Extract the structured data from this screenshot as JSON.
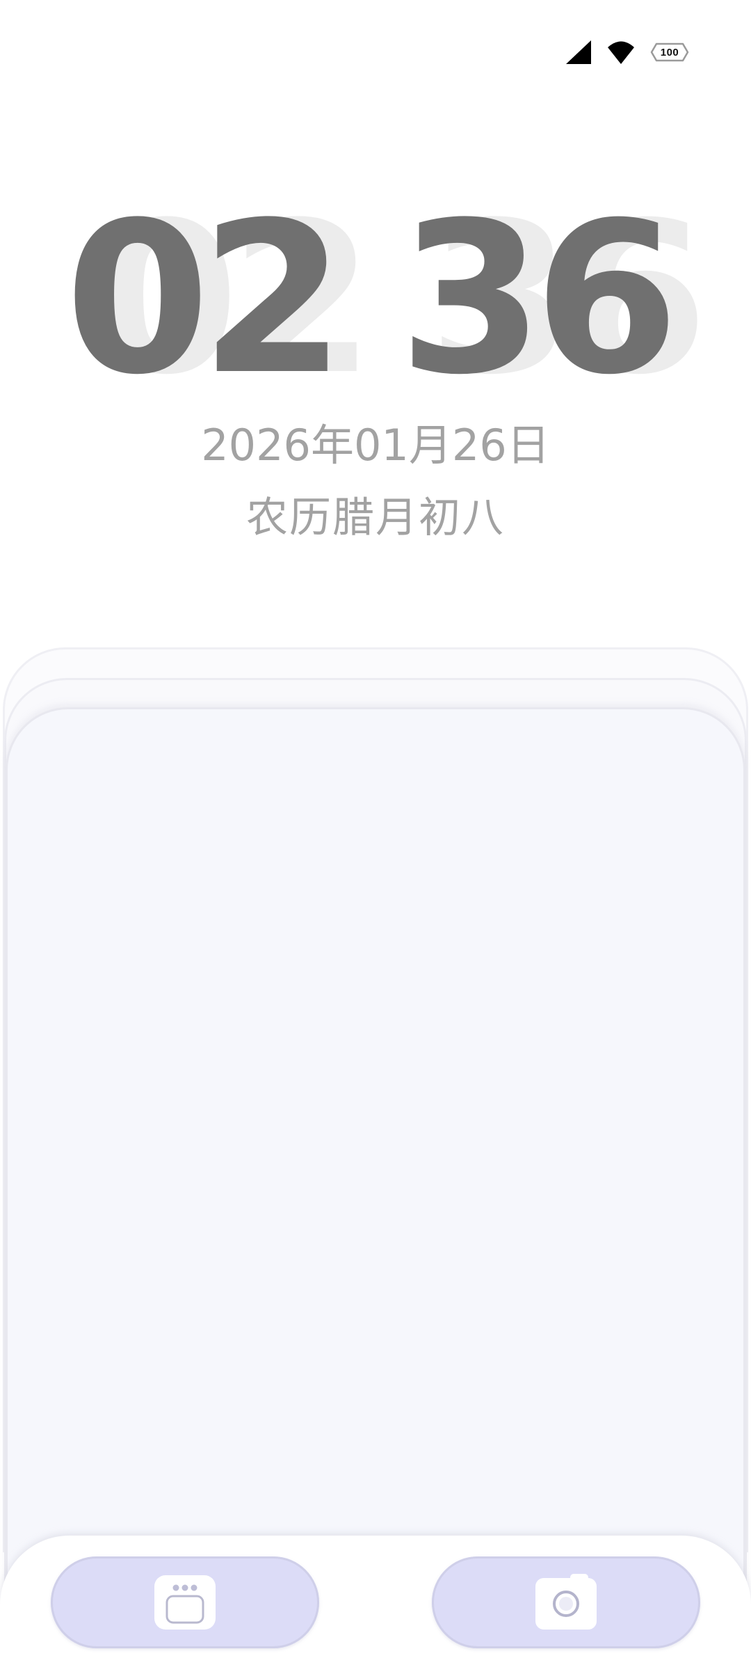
{
  "status_bar": {
    "signal_icon": "cellular-signal-icon",
    "wifi_icon": "wifi-icon",
    "battery_level": "100"
  },
  "lock_screen": {
    "time": "02 36",
    "date_gregorian": "2026年01月26日",
    "date_lunar": "农历腊月初八"
  },
  "shortcuts": {
    "left_icon": "calendar-widget-icon",
    "right_icon": "camera-icon",
    "accent_color": "#dcdcf7"
  }
}
